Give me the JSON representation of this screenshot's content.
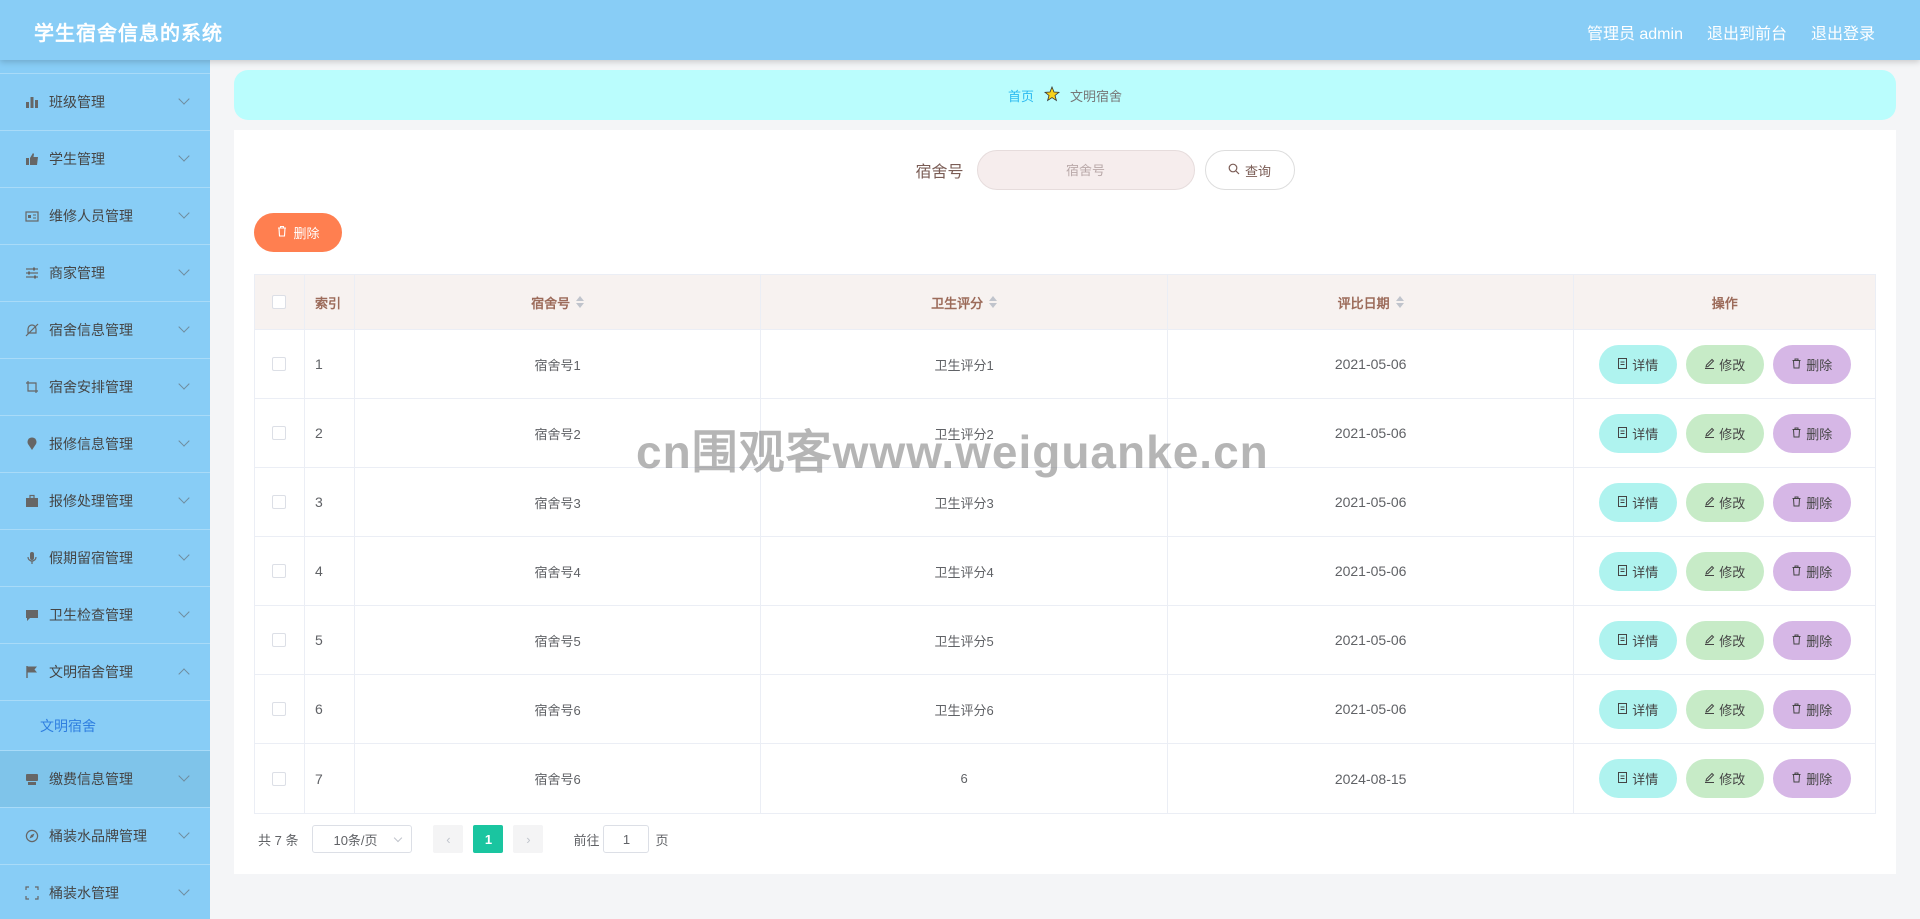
{
  "header": {
    "title": "学生宿舍信息的系统",
    "admin_label": "管理员 admin",
    "to_front_label": "退出到前台",
    "logout_label": "退出登录"
  },
  "sidebar": {
    "items": [
      {
        "label": "班级管理",
        "icon": "bar-chart-icon"
      },
      {
        "label": "学生管理",
        "icon": "thumbs-up-icon"
      },
      {
        "label": "维修人员管理",
        "icon": "id-card-icon"
      },
      {
        "label": "商家管理",
        "icon": "sliders-icon"
      },
      {
        "label": "宿舍信息管理",
        "icon": "bell-off-icon"
      },
      {
        "label": "宿舍安排管理",
        "icon": "crop-icon"
      },
      {
        "label": "报修信息管理",
        "icon": "location-pin-icon"
      },
      {
        "label": "报修处理管理",
        "icon": "briefcase-icon"
      },
      {
        "label": "假期留宿管理",
        "icon": "microphone-icon"
      },
      {
        "label": "卫生检查管理",
        "icon": "chat-icon"
      },
      {
        "label": "文明宿舍管理",
        "icon": "flag-icon"
      },
      {
        "label": "缴费信息管理",
        "icon": "cup-icon"
      },
      {
        "label": "桶装水品牌管理",
        "icon": "compass-icon"
      },
      {
        "label": "桶装水管理",
        "icon": "fullscreen-icon"
      }
    ],
    "submenu_label": "文明宿舍"
  },
  "breadcrumb": {
    "home": "首页",
    "current": "文明宿舍"
  },
  "search": {
    "label": "宿舍号",
    "placeholder": "宿舍号",
    "query_label": "查询"
  },
  "toolbar": {
    "delete_label": "删除"
  },
  "table": {
    "headers": {
      "index": "索引",
      "dorm": "宿舍号",
      "score": "卫生评分",
      "date": "评比日期",
      "ops": "操作"
    },
    "rows": [
      {
        "index": "1",
        "dorm": "宿舍号1",
        "score": "卫生评分1",
        "date": "2021-05-06"
      },
      {
        "index": "2",
        "dorm": "宿舍号2",
        "score": "卫生评分2",
        "date": "2021-05-06"
      },
      {
        "index": "3",
        "dorm": "宿舍号3",
        "score": "卫生评分3",
        "date": "2021-05-06"
      },
      {
        "index": "4",
        "dorm": "宿舍号4",
        "score": "卫生评分4",
        "date": "2021-05-06"
      },
      {
        "index": "5",
        "dorm": "宿舍号5",
        "score": "卫生评分5",
        "date": "2021-05-06"
      },
      {
        "index": "6",
        "dorm": "宿舍号6",
        "score": "卫生评分6",
        "date": "2021-05-06"
      },
      {
        "index": "7",
        "dorm": "宿舍号6",
        "score": "6",
        "date": "2024-08-15"
      }
    ],
    "op_detail": "详情",
    "op_edit": "修改",
    "op_delete": "删除"
  },
  "pagination": {
    "total": "共 7 条",
    "page_size": "10条/页",
    "current_page": "1",
    "goto_prefix": "前往",
    "goto_value": "1",
    "goto_suffix": "页"
  },
  "watermark": "cn围观客www.weiguanke.cn"
}
